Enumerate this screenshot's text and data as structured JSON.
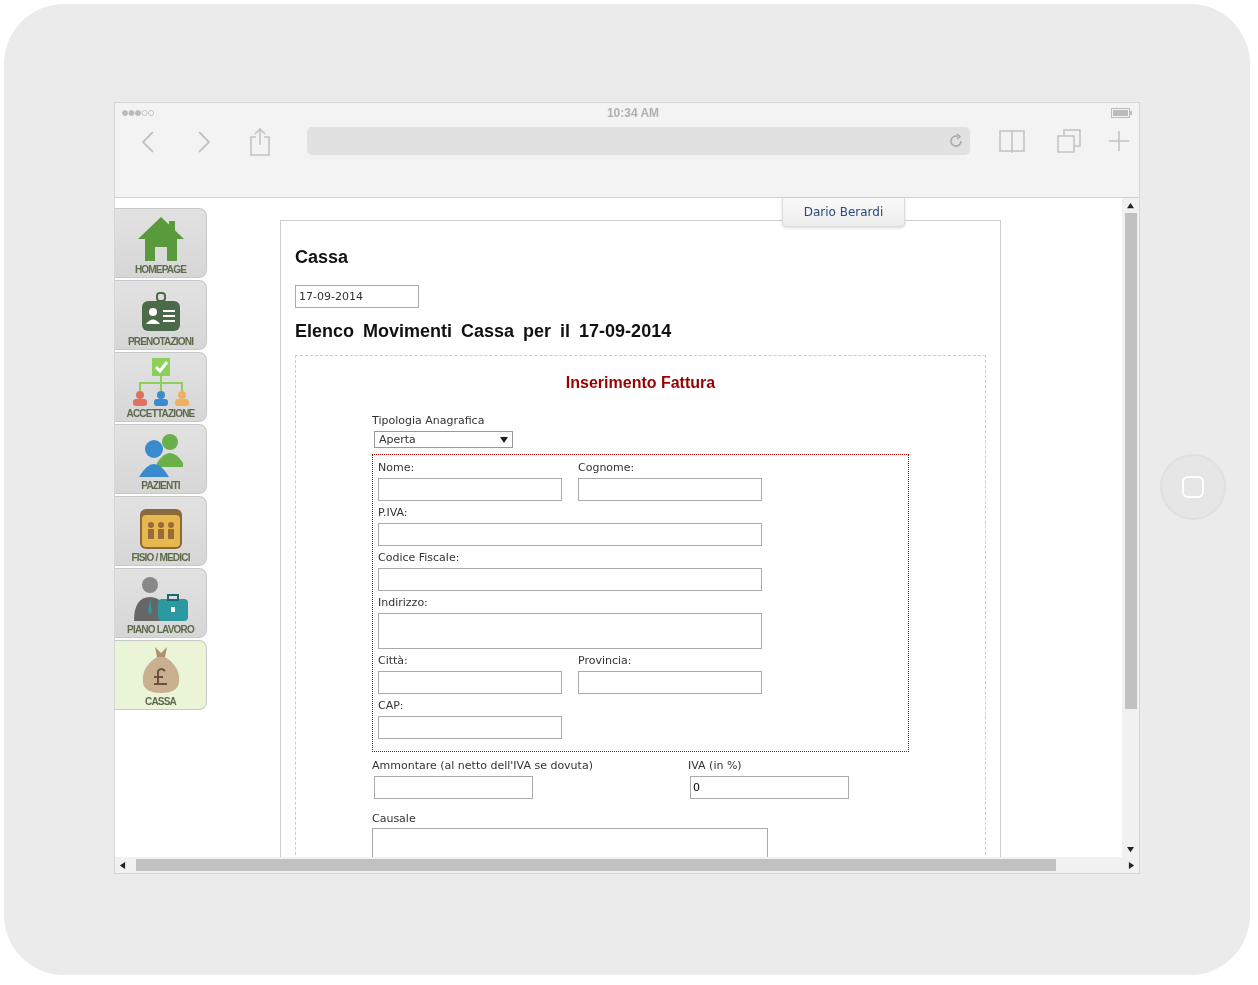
{
  "browser": {
    "time": "10:34 AM"
  },
  "sidebar": {
    "items": [
      {
        "label": "HOMEPAGE",
        "selected": false
      },
      {
        "label": "PRENOTAZIONI",
        "selected": false
      },
      {
        "label": "ACCETTAZIONE",
        "selected": false
      },
      {
        "label": "PAZIENTI",
        "selected": false
      },
      {
        "label": "FISIO / MEDICI",
        "selected": false
      },
      {
        "label": "PIANO LAVORO",
        "selected": false
      },
      {
        "label": "CASSA",
        "selected": true
      }
    ]
  },
  "user_tab": "Dario Berardi",
  "page": {
    "title": "Cassa",
    "date_field": {
      "value": "17-09-2014"
    },
    "heading": "Elenco Movimenti Cassa per il 17-09-2014"
  },
  "form": {
    "title": "Inserimento Fattura",
    "tipologia": {
      "label": "Tipologia Anagrafica",
      "value": "Aperta"
    },
    "registry_rows": [
      [
        {
          "label": "Nome:",
          "kind": "half"
        },
        {
          "label": "Cognome:",
          "kind": "half"
        }
      ],
      [
        {
          "label": "P.IVA:",
          "kind": "full"
        }
      ],
      [
        {
          "label": "Codice Fiscale:",
          "kind": "full"
        }
      ],
      [
        {
          "label": "Indirizzo:",
          "kind": "tall"
        }
      ],
      [
        {
          "label": "Città:",
          "kind": "half"
        },
        {
          "label": "Provincia:",
          "kind": "half"
        }
      ],
      [
        {
          "label": "CAP:",
          "kind": "half"
        }
      ]
    ],
    "amount_fields": [
      {
        "label": "Ammontare (al netto dell'IVA se dovuta)"
      },
      {
        "label": "IVA (in %)",
        "value": "0"
      }
    ],
    "causale": {
      "label": "Causale"
    }
  }
}
